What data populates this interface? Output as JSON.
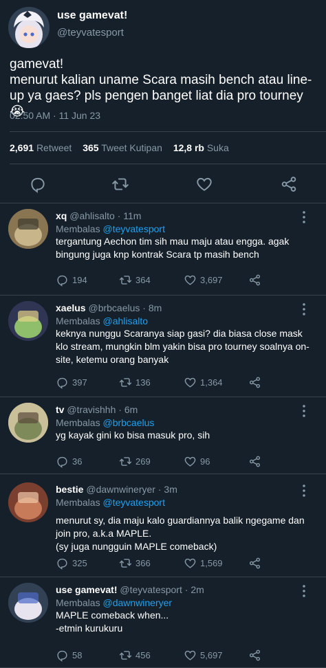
{
  "main_tweet": {
    "display_name": "use gamevat!",
    "handle": "@teyvatesport",
    "text": "gamevat!\nmenurut kalian uname Scara masih bench atau line-up ya gaes? pls pengen banget liat dia pro tourney 😭",
    "timestamp": "02:50 AM · 11 Jun 23",
    "stats": {
      "retweets_count": "2,691",
      "retweets_label": "Retweet",
      "quotes_count": "365",
      "quotes_label": "Tweet Kutipan",
      "likes_count": "12,8 rb",
      "likes_label": "Suka"
    },
    "action_icons": [
      "reply-icon",
      "retweet-icon",
      "like-icon",
      "share-icon"
    ]
  },
  "replying_prefix": "Membalas",
  "replies": [
    {
      "name": "xq",
      "handle": "@ahlisalto",
      "time": "11m",
      "replying_to": "@teyvatesport",
      "text": "tergantung Aechon tim sih mau maju atau engga. agak bingung juga knp kontrak Scara tp masih bench",
      "replies": "194",
      "retweets": "364",
      "likes": "3,697"
    },
    {
      "name": "xaelus",
      "handle": "@brbcaelus",
      "time": "8m",
      "replying_to": "@ahlisalto",
      "text": "keknya nunggu Scaranya siap gasi? dia biasa close mask klo stream, mungkin blm yakin bisa pro tourney soalnya on-site, ketemu orang banyak",
      "replies": "397",
      "retweets": "136",
      "likes": "1,364"
    },
    {
      "name": "tv",
      "handle": "@travishhh",
      "time": "6m",
      "replying_to": "@brbcaelus",
      "text": "yg kayak gini ko bisa masuk pro, sih",
      "replies": "36",
      "retweets": "269",
      "likes": "96"
    },
    {
      "name": "bestie",
      "handle": "@dawnwineryer",
      "time": "3m",
      "replying_to": "@teyvatesport",
      "text": "menurut sy, dia maju kalo guardiannya balik ngegame dan join pro, a.k.a MAPLE.\n(sy juga nungguin MAPLE comeback)",
      "replies": "325",
      "retweets": "366",
      "likes": "1,569"
    },
    {
      "name": "use gamevat!",
      "handle": "@teyvatesport",
      "time": "2m",
      "replying_to": "@dawnwineryer",
      "text": "MAPLE comeback when...\n-etmin kurukuru",
      "replies": "58",
      "retweets": "456",
      "likes": "5,697"
    }
  ],
  "colors": {
    "background": "#15202b",
    "secondary_text": "#8899a6",
    "link": "#1da1f2",
    "divider": "#38444d"
  }
}
